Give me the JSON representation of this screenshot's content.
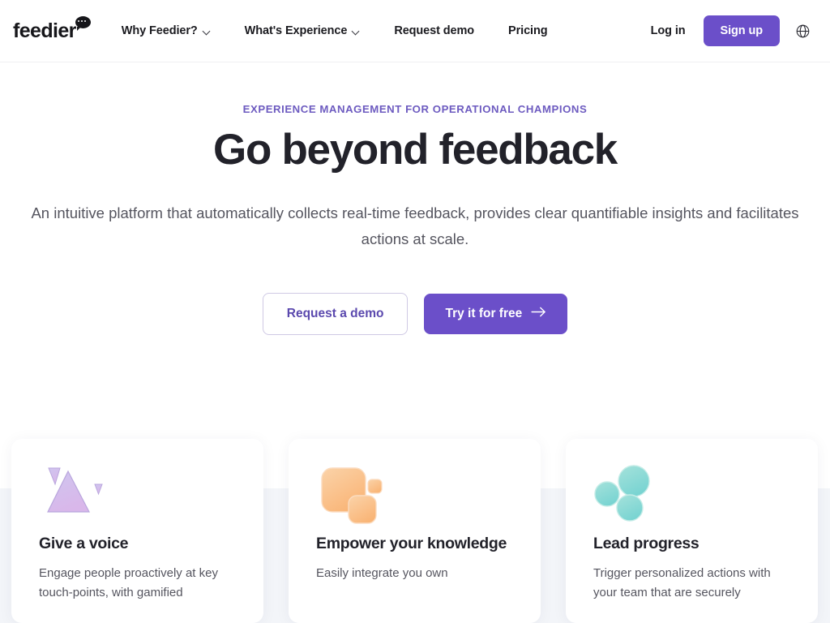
{
  "header": {
    "logo_text": "feedier",
    "logo_icon": "speech-bubble-dots-icon",
    "nav": [
      {
        "label": "Why Feedier?",
        "has_chevron": true
      },
      {
        "label": "What's Experience",
        "has_chevron": true
      },
      {
        "label": "Request demo",
        "has_chevron": false
      },
      {
        "label": "Pricing",
        "has_chevron": false
      }
    ],
    "login_label": "Log in",
    "signup_label": "Sign up",
    "language_icon": "globe-icon"
  },
  "hero": {
    "eyebrow": "EXPERIENCE MANAGEMENT FOR OPERATIONAL CHAMPIONS",
    "title": "Go beyond feedback",
    "subtitle": "An intuitive platform that automatically collects real-time feedback, provides clear quantifiable insights and facilitates actions at scale.",
    "cta_secondary": "Request a demo",
    "cta_primary": "Try it for free",
    "cta_primary_icon": "arrow-right-icon"
  },
  "features": [
    {
      "icon": "triangles-icon",
      "title": "Give a voice",
      "desc": "Engage people proactively at key touch-points, with gamified"
    },
    {
      "icon": "rounded-squares-icon",
      "title": "Empower your knowledge",
      "desc": "Easily integrate you own"
    },
    {
      "icon": "circles-icon",
      "title": "Lead progress",
      "desc": "Trigger personalized actions with your team that are securely"
    }
  ],
  "colors": {
    "brand_purple": "#6b4fc9",
    "eyebrow_purple": "#6d5bc0",
    "heading_dark": "#22222a",
    "body_gray": "#55555f",
    "section_bg": "#f3f5f9",
    "icon_purple": "#c9b3e8",
    "icon_orange": "#f9c395",
    "icon_teal": "#8bd9d2"
  }
}
